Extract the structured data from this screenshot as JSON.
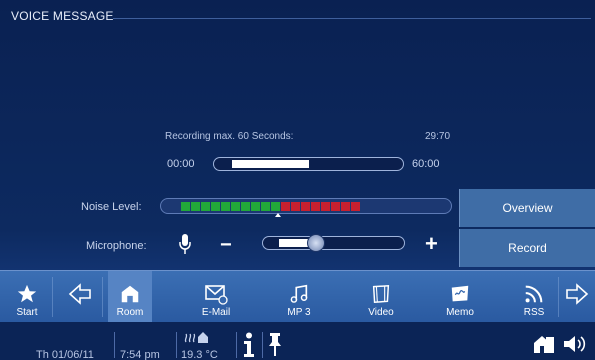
{
  "header": {
    "title": "VOICE MESSAGE"
  },
  "recording": {
    "label": "Recording max. 60 Seconds:",
    "remaining": "29:70",
    "start": "00:00",
    "end": "60:00",
    "progress": 0.5
  },
  "noise": {
    "label": "Noise Level:",
    "green_segments": 10,
    "red_segments": 8
  },
  "microphone": {
    "label": "Microphone:",
    "minus": "−",
    "plus": "+",
    "level": 0.3
  },
  "buttons": {
    "overview": "Overview",
    "record": "Record"
  },
  "nav": {
    "start": "Start",
    "items": [
      {
        "label": "Room",
        "icon": "room-icon"
      },
      {
        "label": "E-Mail",
        "icon": "email-icon"
      },
      {
        "label": "MP 3",
        "icon": "music-icon"
      },
      {
        "label": "Video",
        "icon": "video-icon"
      },
      {
        "label": "Memo",
        "icon": "memo-icon"
      },
      {
        "label": "RSS",
        "icon": "rss-icon"
      }
    ]
  },
  "status": {
    "date": "Th 01/06/11",
    "time": "7:54 pm",
    "temperature": "19.3 °C"
  },
  "colors": {
    "green": "#22a83a",
    "red": "#c8202f",
    "button": "#3f6da6",
    "nav": "#3567ad"
  }
}
